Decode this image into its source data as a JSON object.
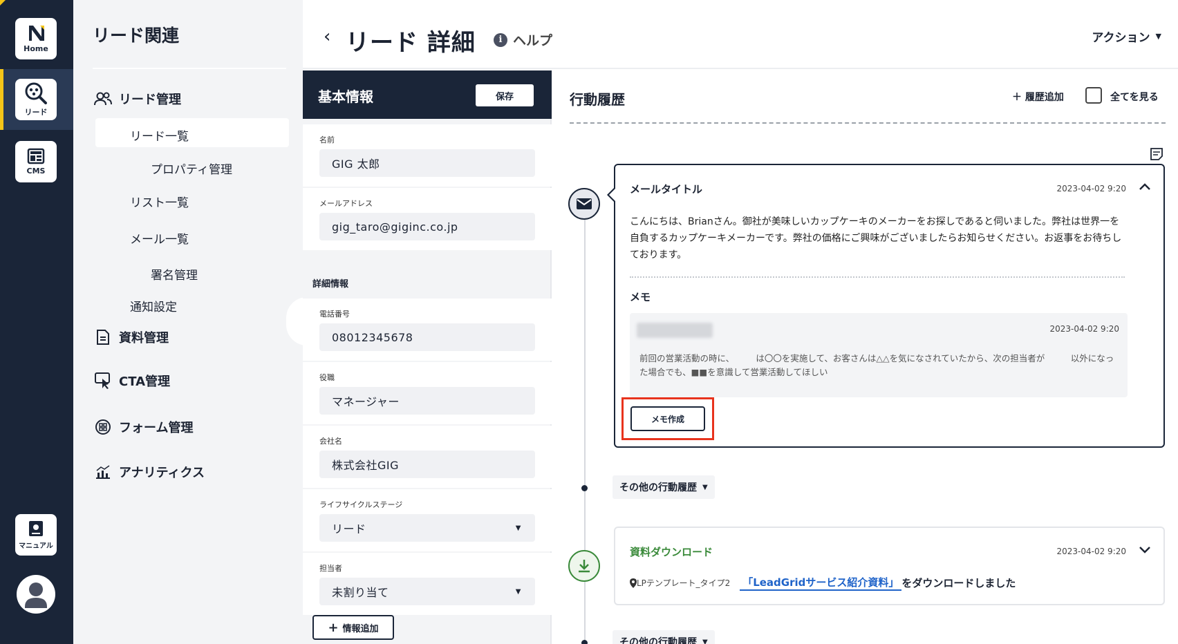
{
  "rail": {
    "home_label": "Home",
    "lead_label": "リード",
    "cms_label": "CMS",
    "manual_label": "マニュアル"
  },
  "nav": {
    "title": "リード関連",
    "lead_mgmt": "リード管理",
    "lead_list": "リード一覧",
    "property_mgmt": "プロパティ管理",
    "list_list": "リスト一覧",
    "mail_list": "メール一覧",
    "signature_mgmt": "署名管理",
    "notification": "通知設定",
    "document_mgmt": "資料管理",
    "cta_mgmt": "CTA管理",
    "form_mgmt": "フォーム管理",
    "analytics": "アナリティクス"
  },
  "header": {
    "back": "‹",
    "title": "リード 詳細",
    "help": "ヘルプ",
    "action": "アクション"
  },
  "info": {
    "title": "基本情報",
    "save": "保存",
    "name_label": "名前",
    "name_value": "GIG 太郎",
    "email_label": "メールアドレス",
    "email_value": "gig_taro@giginc.co.jp",
    "detail_section": "詳細情報",
    "phone_label": "電話番号",
    "phone_value": "08012345678",
    "role_label": "役職",
    "role_value": "マネージャー",
    "company_label": "会社名",
    "company_value": "株式会社GIG",
    "lifecycle_label": "ライフサイクルステージ",
    "lifecycle_value": "リード",
    "owner_label": "担当者",
    "owner_value": "未割り当て",
    "add_info": "情報追加"
  },
  "history": {
    "title": "行動履歴",
    "add": "＋ 履歴追加",
    "see_all": "全てを見る",
    "mail": {
      "title": "メールタイトル",
      "timestamp": "2023-04-02 9:20",
      "body": "こんにちは、Brianさん。御社が美味しいカップケーキのメーカーをお探しであると伺いました。弊社は世界一を自負するカップケーキメーカーです。弊社の価格にご興味がございましたらお知らせください。お返事をお待ちしております。",
      "memo_label": "メモ",
      "memo_timestamp": "2023-04-02 9:20",
      "memo_text": "前回の営業活動の時に、　　　は〇〇を実施して、お客さんは△△を気になされていたから、次の担当者が　　　以外になった場合でも、■■を意識して営業活動してほしい",
      "memo_button": "メモ作成"
    },
    "other_label": "その他の行動履歴",
    "download": {
      "title": "資料ダウンロード",
      "timestamp": "2023-04-02 9:20",
      "location": "LPテンプレート_タイプ2",
      "link": "「LeadGridサービス紹介資料」",
      "rest": "をダウンロードしました"
    }
  },
  "colors": {
    "navy": "#1a2538",
    "accent_yellow": "#f5c518",
    "highlight_red": "#e8331d",
    "download_green": "#3a8a3a",
    "link_blue": "#1f63c9"
  }
}
